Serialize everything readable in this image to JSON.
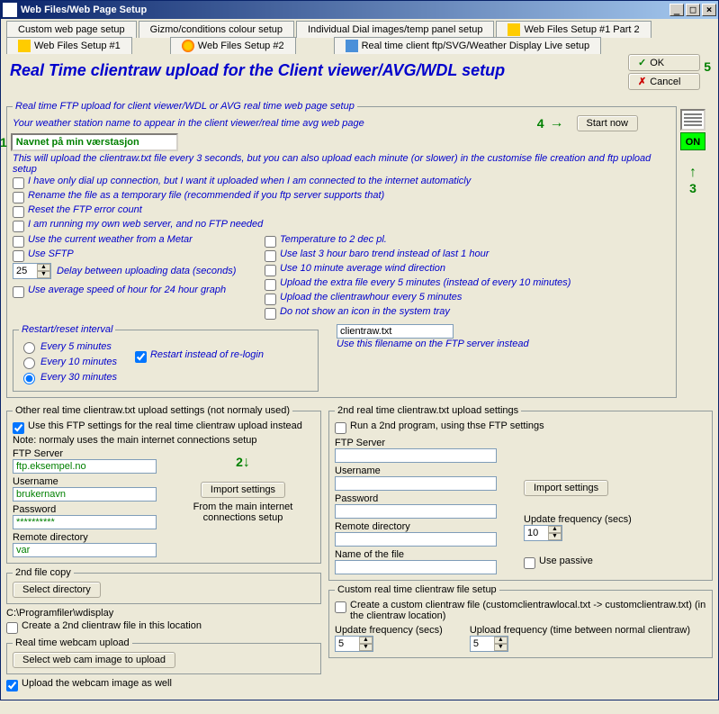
{
  "window": {
    "title": "Web Files/Web Page Setup"
  },
  "titlebtns": {
    "min": "_",
    "max": "□",
    "close": "×"
  },
  "tabs": {
    "r1a": "Custom web page setup",
    "r1b": "Gizmo/conditions colour setup",
    "r1c": "Individual Dial images/temp panel setup",
    "r1d": "Web Files Setup #1 Part 2",
    "r2a": "Web Files Setup #1",
    "r2b": "Web Files Setup #2",
    "r2c": "Real time client ftp/SVG/Weather Display Live setup"
  },
  "heading": "Real Time clientraw upload for the Client viewer/AVG/WDL setup",
  "okbtn": "OK",
  "cancelbtn": "Cancel",
  "nums": {
    "n1": "1",
    "n2": "2",
    "n3": "3",
    "n4": "4",
    "n5": "5"
  },
  "group1": {
    "legend": "Real time FTP upload for client viewer/WDL or AVG real time web page setup",
    "line1": "Your weather station name to appear in the client viewer/real time avg web page",
    "station": "Navnet på min værstasjon",
    "startnow": "Start now",
    "on": "ON",
    "desc": "This will upload the clientraw.txt file every 3 seconds, but you can also upload each minute (or slower) in the customise file creation and ftp upload setup",
    "c1": "I have only dial up connection, but I want it uploaded when I am connected to the internet automaticly",
    "c2": "Rename the file as a temporary file (recommended if you ftp server supports that)",
    "c3": "Reset the FTP error count",
    "c4": "I am running my own web server, and no FTP needed",
    "c5": "Use the current weather from a Metar",
    "c6": "Use SFTP",
    "delayval": "25",
    "delaylbl": "Delay between uploading data (seconds)",
    "c7": "Use average speed of hour for 24 hour graph",
    "r1": "Temperature to 2 dec pl.",
    "r2": "Use last 3 hour baro trend instead of last 1 hour",
    "r3": "Use 10 minute average wind direction",
    "r4": "Upload the extra file every 5 minutes (instead of every 10 minutes)",
    "r5": "Upload the clientrawhour every 5 minutes",
    "r6": "Do not show an icon in the system tray"
  },
  "restart": {
    "legend": "Restart/reset interval",
    "o1": "Every 5 minutes",
    "o2": "Every 10 minutes",
    "o3": "Every 30 minutes",
    "chk": "Restart instead of re-login",
    "fname": "clientraw.txt",
    "fnote": "Use this filename on the FTP server instead"
  },
  "other": {
    "legend": "Other real time clientraw.txt upload settings (not normaly  used)",
    "c1": "Use this FTP settings for the real time clientraw upload instead",
    "note": "Note: normaly uses the main internet connections setup",
    "ftps": "FTP Server",
    "ftpsv": "ftp.eksempel.no",
    "user": "Username",
    "userv": "brukernavn",
    "pass": "Password",
    "passv": "**********",
    "rdir": "Remote directory",
    "rdirv": "var",
    "import": "Import settings",
    "importnote": "From the main internet connections setup"
  },
  "copy2": {
    "legend": "2nd file copy",
    "btn": "Select directory",
    "path": "C:\\Programfiler\\wdisplay",
    "chk": "Create a 2nd clientraw file in this location"
  },
  "webcam": {
    "legend": "Real time webcam upload",
    "btn": "Select web cam image to upload",
    "chk": "Upload the webcam image as well"
  },
  "second": {
    "legend": "2nd real time clientraw.txt upload settings",
    "c1": "Run a  2nd program, using thse FTP settings",
    "ftps": "FTP Server",
    "user": "Username",
    "pass": "Password",
    "rdir": "Remote directory",
    "nfile": "Name of the file",
    "import": "Import settings",
    "freq": "Update frequency (secs)",
    "freqv": "10",
    "passive": "Use passive"
  },
  "custom": {
    "legend": "Custom real time clientraw file setup",
    "c1": "Create a custom clientraw file (customclientrawlocal.txt -> customclientraw.txt) (in the clientraw location)",
    "upd": "Update frequency (secs)",
    "updv": "5",
    "upl": "Upload frequency (time between normal clientraw)",
    "uplv": "5"
  }
}
